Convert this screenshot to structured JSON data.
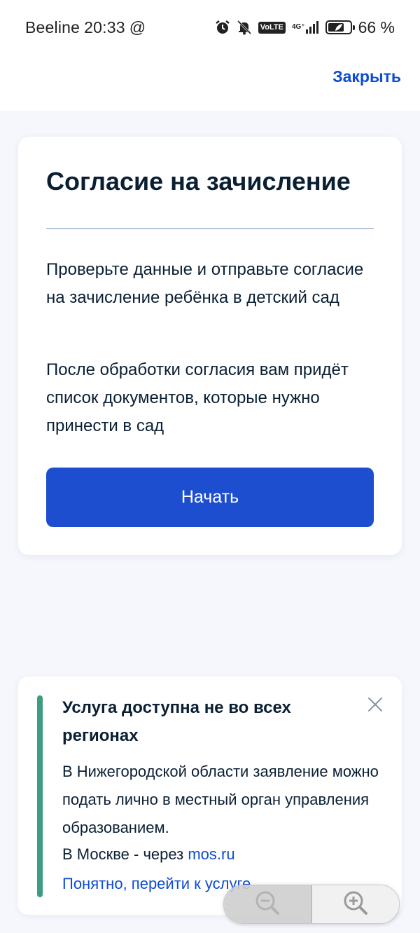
{
  "status_bar": {
    "carrier": "Beeline",
    "time": "20:33",
    "at_symbol": "@",
    "volte": "VoLTE",
    "network": "4G⁺",
    "battery_percent": "66 %",
    "battery_level": 0.66,
    "icons": [
      "alarm-icon",
      "bell-off-icon",
      "volte-icon",
      "signal-icon",
      "battery-icon"
    ]
  },
  "header": {
    "close_label": "Закрыть"
  },
  "main_card": {
    "title": "Согласие на зачисление",
    "paragraph_1": "Проверьте данные и отправьте согласие на зачисление ребёнка в детский сад",
    "paragraph_2": "После обработки согласия вам придёт список документов, которые нужно принести в сад",
    "start_button": "Начать"
  },
  "notice": {
    "title": "Услуга доступна не во всех регионах",
    "text": "В Нижегородской области заявление можно подать лично в местный орган управления образованием.",
    "moscow_prefix": "В Москве - через ",
    "moscow_link": "mos.ru",
    "action_link": "Понятно, перейти к услуге",
    "accent_color": "#3d9c82"
  },
  "zoom": {
    "out_icon": "zoom-out-icon",
    "in_icon": "zoom-in-icon"
  },
  "colors": {
    "primary": "#1d4ed0",
    "link": "#0d4cd3",
    "background": "#f5f7fc"
  }
}
